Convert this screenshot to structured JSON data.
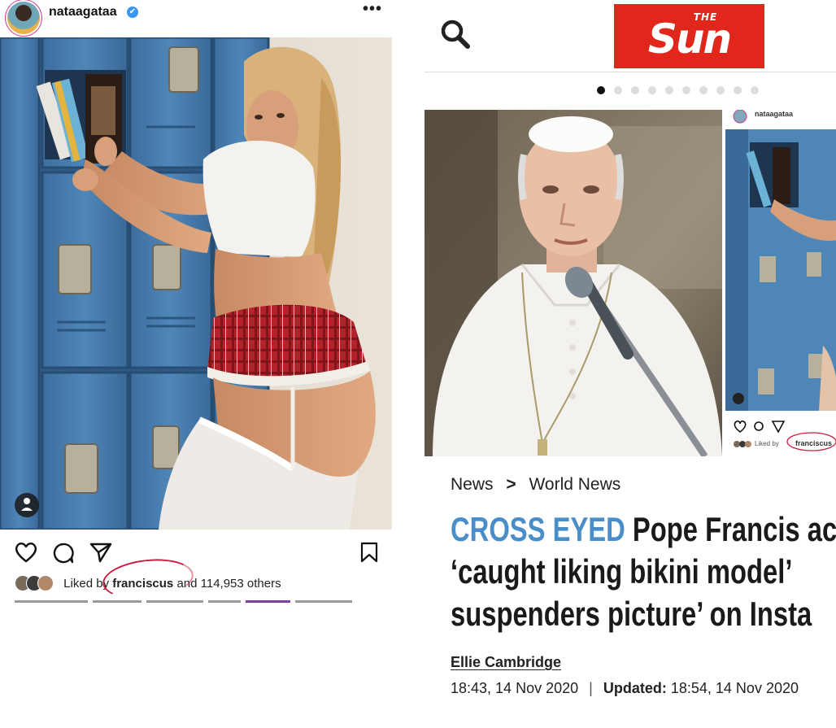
{
  "instagram": {
    "username": "nataagataa",
    "verified_glyph": "✔",
    "more_glyph": "•••",
    "likes_prefix": "Liked by",
    "liked_by_user": "franciscus",
    "likes_suffix": "and 114,953 others",
    "icons": [
      "heart-icon",
      "comment-icon",
      "share-icon",
      "bookmark-icon",
      "person-tag-icon"
    ],
    "annotation_color": "#c81d3f"
  },
  "sun": {
    "logo_the": "THE",
    "logo_word": "Sun",
    "brand_color": "#e1261c",
    "carousel": {
      "total": 10,
      "active_index": 0
    },
    "inset": {
      "username": "nataagataa",
      "likes_prefix": "Liked by",
      "liked_by_user": "franciscus"
    },
    "breadcrumb": {
      "section": "News",
      "separator": ">",
      "subsection": "World News"
    },
    "headline": {
      "kicker": "CROSS EYED",
      "line1": " Pope Francis ac",
      "line2": "‘caught liking bikini model’",
      "line3": "suspenders picture’ on Insta",
      "kicker_color": "#4a8ec9"
    },
    "author": "Ellie Cambridge",
    "published": "18:43, 14 Nov 2020",
    "updated_label": "Updated:",
    "updated": "18:54, 14 Nov 2020"
  }
}
